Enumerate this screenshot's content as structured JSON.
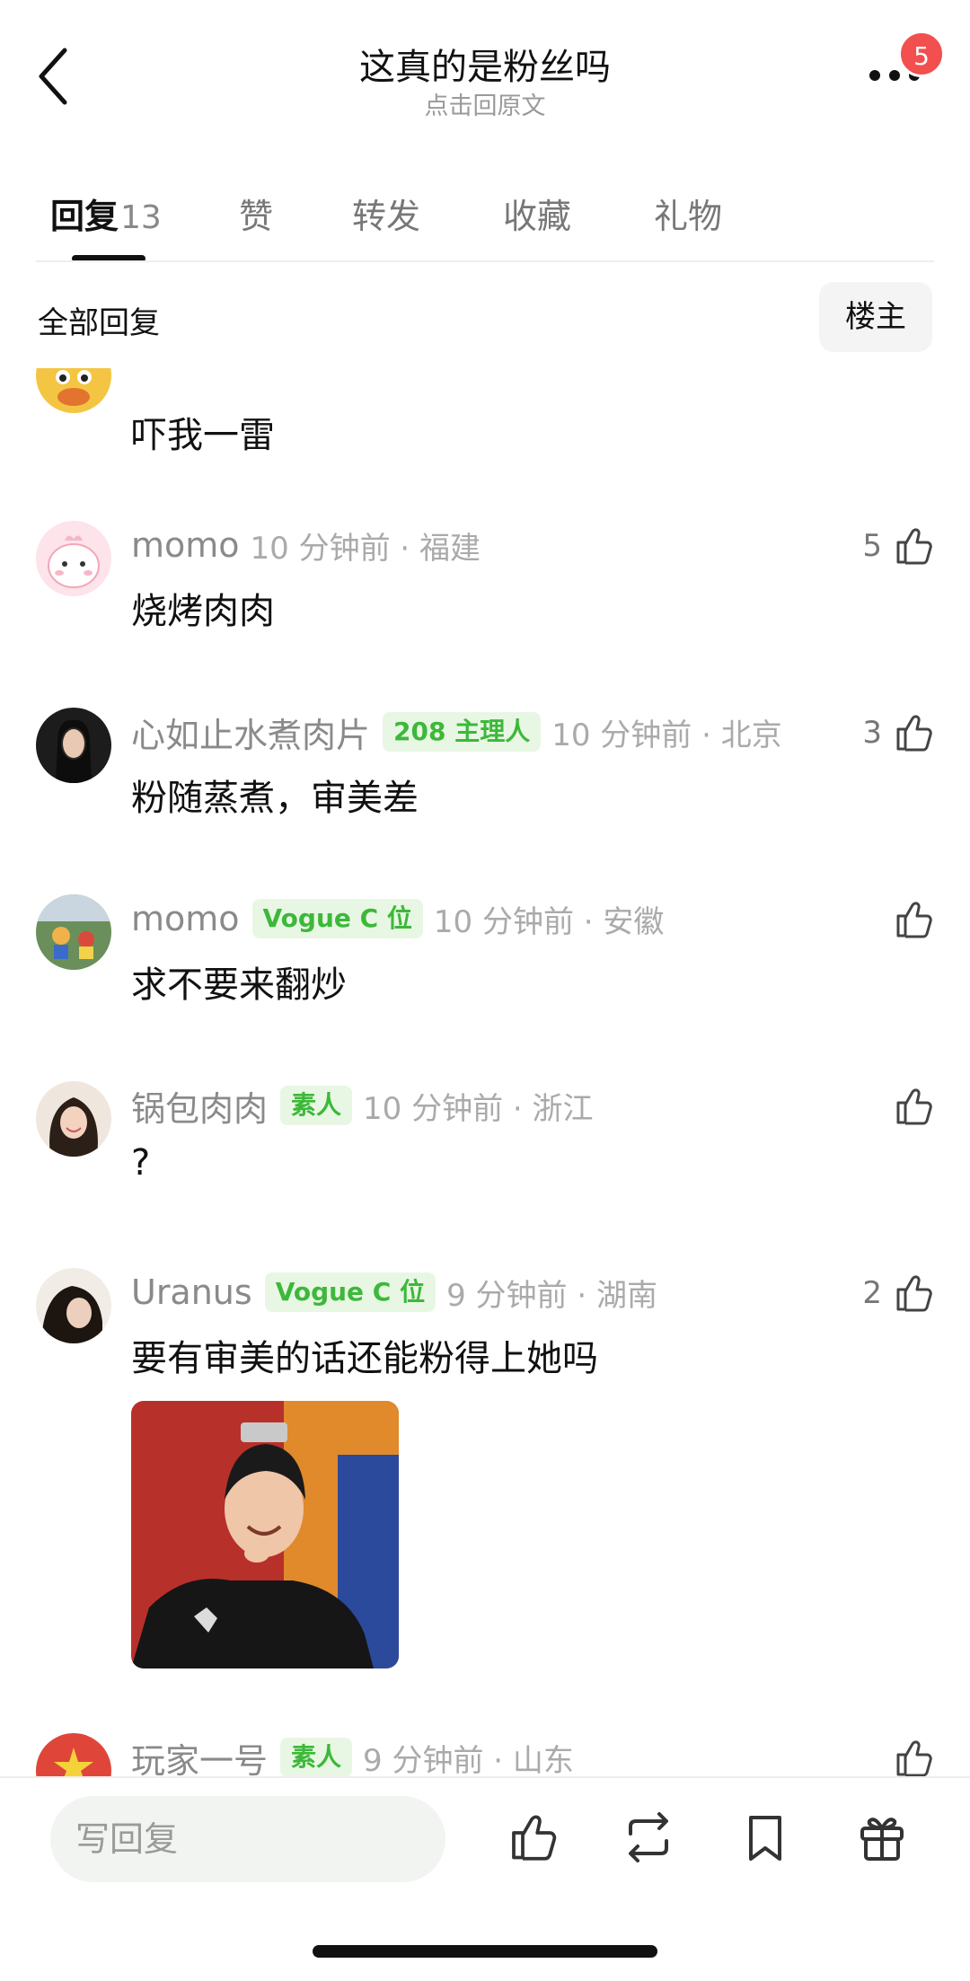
{
  "header": {
    "title": "这真的是粉丝吗",
    "subtitle": "点击回原文",
    "notification_count": "5",
    "icons": [
      "back-arrow-icon",
      "more-dots-icon"
    ]
  },
  "tabs": [
    {
      "label": "回复",
      "count": "13",
      "active": true
    },
    {
      "label": "赞"
    },
    {
      "label": "转发"
    },
    {
      "label": "收藏"
    },
    {
      "label": "礼物"
    }
  ],
  "filter": {
    "label": "全部回复",
    "owner_button": "楼主"
  },
  "comments": [
    {
      "username": "",
      "badge": "",
      "time": "",
      "content": "吓我一雷",
      "likes": ""
    },
    {
      "username": "momo",
      "badge": "",
      "time": "10 分钟前 · 福建",
      "content": "烧烤肉肉",
      "likes": "5"
    },
    {
      "username": "心如止水煮肉片",
      "badge": "208 主理人",
      "time": "10 分钟前 · 北京",
      "content": "粉随蒸煮，审美差",
      "likes": "3"
    },
    {
      "username": "momo",
      "badge": "Vogue C 位",
      "time": "10 分钟前 · 安徽",
      "content": "求不要来翻炒",
      "likes": ""
    },
    {
      "username": "锅包肉肉",
      "badge": "素人",
      "time": "10 分钟前 · 浙江",
      "content": "?",
      "likes": ""
    },
    {
      "username": "Uranus",
      "badge": "Vogue C 位",
      "time": "9 分钟前 · 湖南",
      "content": "要有审美的话还能粉得上她吗",
      "likes": "2"
    },
    {
      "username": "玩家一号",
      "badge": "素人",
      "time": "9 分钟前 · 山东",
      "content": "",
      "likes": ""
    }
  ],
  "bottom_bar": {
    "reply_placeholder": "写回复",
    "icons": [
      "like-icon",
      "repost-icon",
      "bookmark-icon",
      "gift-icon"
    ]
  },
  "colors": {
    "badge_green": "#3db83a",
    "badge_bg": "#e8f7e4",
    "notification_red": "#f24f4f"
  }
}
